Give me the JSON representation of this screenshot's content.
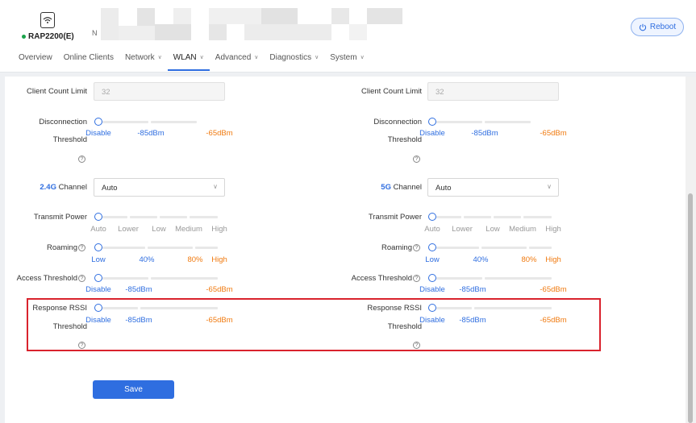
{
  "header": {
    "device_name": "RAP2200(E)",
    "partial_char": "N",
    "reboot_label": "Reboot"
  },
  "tabs": [
    {
      "label": "Overview",
      "has_dropdown": false
    },
    {
      "label": "Online Clients",
      "has_dropdown": false
    },
    {
      "label": "Network",
      "has_dropdown": true
    },
    {
      "label": "WLAN",
      "has_dropdown": true,
      "active": true
    },
    {
      "label": "Advanced",
      "has_dropdown": true
    },
    {
      "label": "Diagnostics",
      "has_dropdown": true
    },
    {
      "label": "System",
      "has_dropdown": true
    }
  ],
  "left": {
    "client_count_label": "Client Count Limit",
    "client_count_placeholder": "32",
    "disconnection_label_1": "Disconnection",
    "disconnection_label_2": "Threshold",
    "disconnection_ticks": [
      "Disable",
      "-85dBm",
      "-65dBm"
    ],
    "channel_band": "2.4G",
    "channel_label": "Channel",
    "channel_value": "Auto",
    "transmit_power_label": "Transmit Power",
    "transmit_power_ticks": [
      "Auto",
      "Lower",
      "Low",
      "Medium",
      "High"
    ],
    "roaming_label": "Roaming",
    "roaming_ticks": [
      "Low",
      "40%",
      "80%",
      "High"
    ],
    "access_threshold_label": "Access Threshold",
    "access_threshold_ticks": [
      "Disable",
      "-85dBm",
      "-65dBm"
    ],
    "response_rssi_label_1": "Response RSSI",
    "response_rssi_label_2": "Threshold",
    "response_rssi_ticks": [
      "Disable",
      "-85dBm",
      "-65dBm"
    ]
  },
  "right": {
    "client_count_label": "Client Count Limit",
    "client_count_placeholder": "32",
    "disconnection_label_1": "Disconnection",
    "disconnection_label_2": "Threshold",
    "disconnection_ticks": [
      "Disable",
      "-85dBm",
      "-65dBm"
    ],
    "channel_band": "5G",
    "channel_label": "Channel",
    "channel_value": "Auto",
    "transmit_power_label": "Transmit Power",
    "transmit_power_ticks": [
      "Auto",
      "Lower",
      "Low",
      "Medium",
      "High"
    ],
    "roaming_label": "Roaming",
    "roaming_ticks": [
      "Low",
      "40%",
      "80%",
      "High"
    ],
    "access_threshold_label": "Access Threshold",
    "access_threshold_ticks": [
      "Disable",
      "-85dBm",
      "-65dBm"
    ],
    "response_rssi_label_1": "Response RSSI",
    "response_rssi_label_2": "Threshold",
    "response_rssi_ticks": [
      "Disable",
      "-85dBm",
      "-65dBm"
    ]
  },
  "save_label": "Save",
  "help_glyph": "?",
  "colors": {
    "accent": "#2f6ee0",
    "warning": "#f07a10",
    "highlight_box": "#d9232d"
  }
}
